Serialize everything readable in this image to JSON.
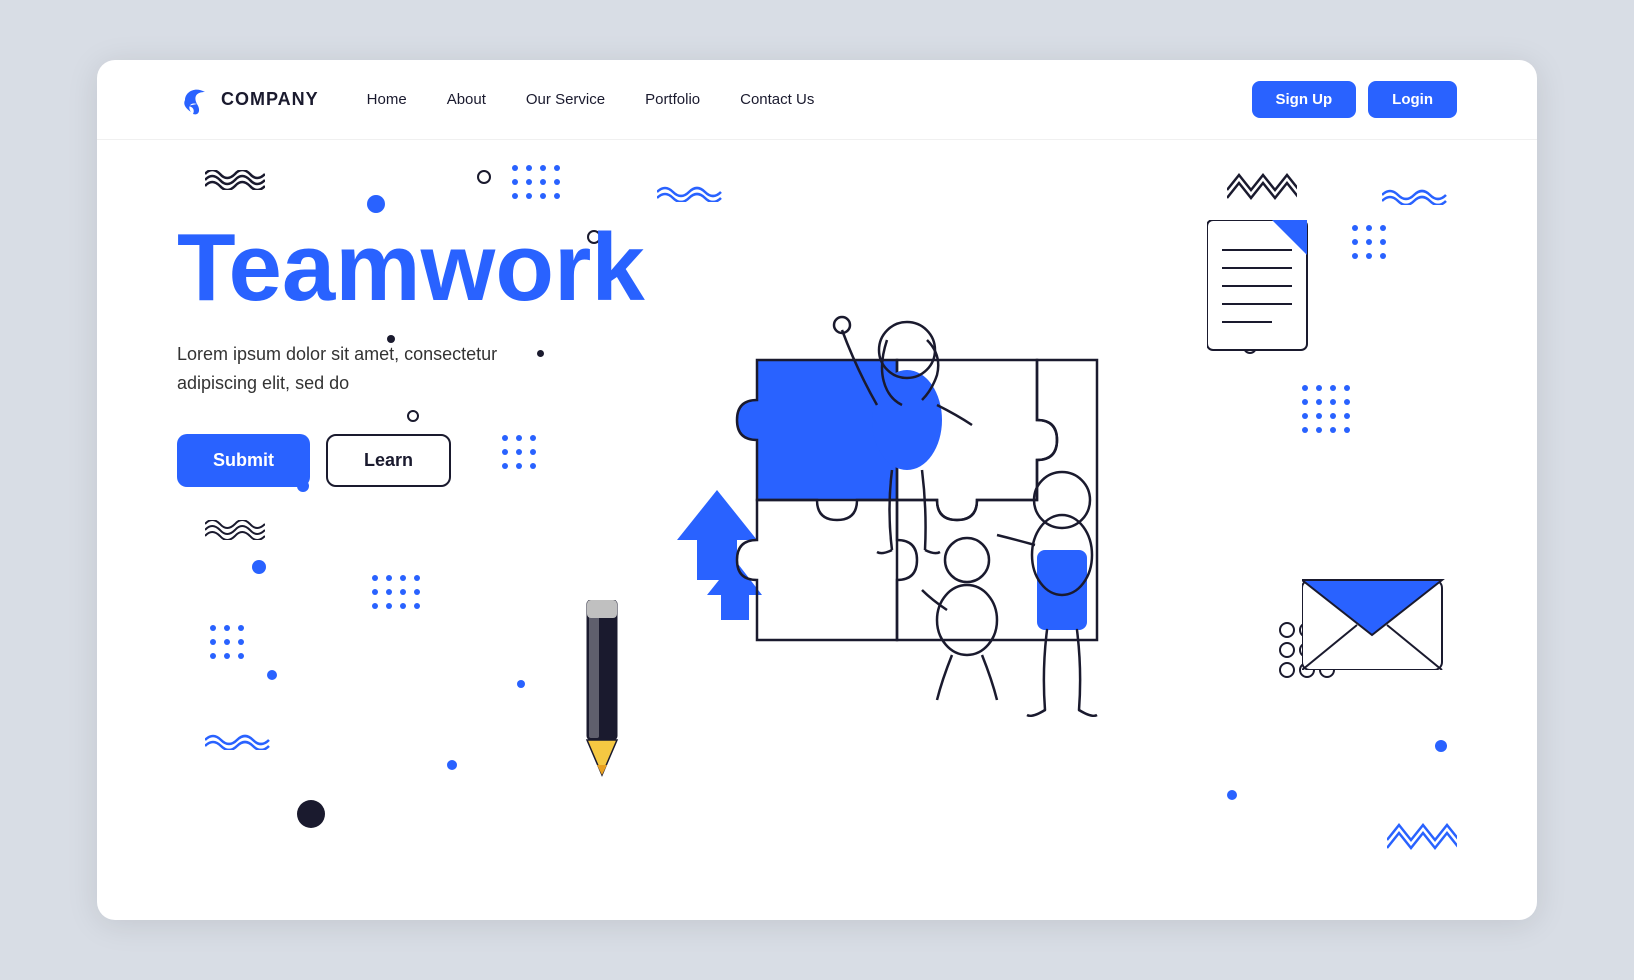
{
  "navbar": {
    "logo_text": "COMPANY",
    "nav_links": [
      {
        "label": "Home",
        "id": "home"
      },
      {
        "label": "About",
        "id": "about"
      },
      {
        "label": "Our Service",
        "id": "service"
      },
      {
        "label": "Portfolio",
        "id": "portfolio"
      },
      {
        "label": "Contact Us",
        "id": "contact"
      }
    ],
    "btn_signup": "Sign Up",
    "btn_login": "Login"
  },
  "hero": {
    "title": "Teamwork",
    "description_line1": "Lorem ipsum dolor sit amet, consectetur",
    "description_line2": "adipiscing elit, sed do",
    "btn_submit": "Submit",
    "btn_learn": "Learn"
  },
  "colors": {
    "blue": "#2962ff",
    "dark": "#1a1a2e",
    "white": "#ffffff"
  }
}
